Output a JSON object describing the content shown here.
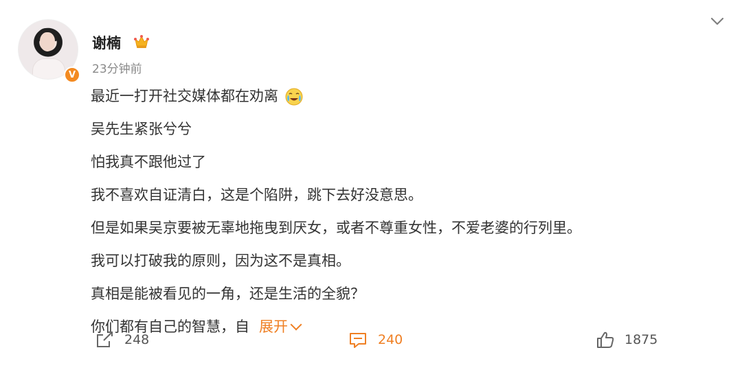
{
  "post": {
    "author": "谢楠",
    "time": "23分钟前",
    "verified_mark": "V",
    "lines": [
      "最近一打开社交媒体都在劝离",
      "吴先生紧张兮兮",
      "怕我真不跟他过了",
      "我不喜欢自证清白，这是个陷阱，跳下去好没意思。",
      "但是如果吴京要被无辜地拖曳到厌女，或者不尊重女性，不爱老婆的行列里。",
      "我可以打破我的原则，因为这不是真相。",
      "真相是能被看见的一角，还是生活的全貌？",
      "你们都有自己的智慧，自"
    ],
    "expand_label": "展开",
    "emoji": "crying-laughing-emoji"
  },
  "actions": {
    "repost_count": "248",
    "comment_count": "240",
    "like_count": "1875"
  },
  "colors": {
    "accent": "#ef7f23",
    "text": "#333333",
    "muted": "#8a8a8a"
  }
}
